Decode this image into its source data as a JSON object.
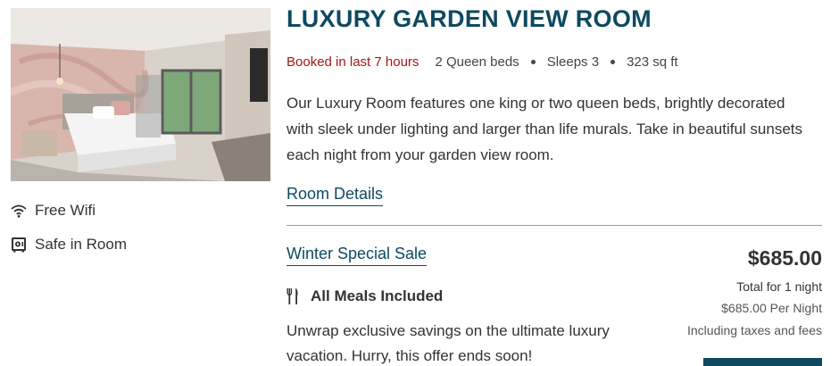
{
  "room": {
    "title": "LUXURY GARDEN VIEW ROOM",
    "booked_text": "Booked in last 7 hours",
    "beds": "2 Queen beds",
    "sleeps": "Sleeps 3",
    "size": "323 sq ft",
    "description": "Our Luxury Room features one king or two queen beds, brightly decorated with sleek under lighting and larger than life murals. Take in beautiful sunsets each night from your garden view room.",
    "details_link": "Room Details",
    "photo_icon": "room-photo"
  },
  "amenities": [
    {
      "label": "Free Wifi",
      "icon": "wifi-icon"
    },
    {
      "label": "Safe in Room",
      "icon": "safe-icon"
    }
  ],
  "offer": {
    "name": "Winter Special Sale",
    "meals_label": "All Meals Included",
    "meals_icon": "utensils-icon",
    "description": "Unwrap exclusive savings on the ultimate luxury vacation. Hurry, this offer ends soon!",
    "price": "$685.00",
    "total_text": "Total for 1 night",
    "per_night": "$685.00 Per Night",
    "taxes_text": "Including taxes and fees"
  },
  "colors": {
    "accent": "#0d4a60",
    "booked": "#a4161a",
    "divider": "#a59a82"
  }
}
